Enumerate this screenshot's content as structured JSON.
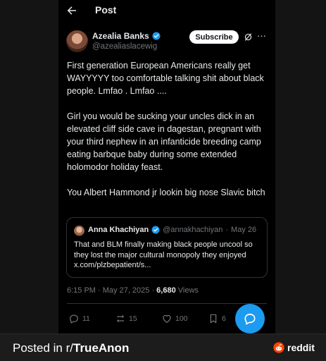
{
  "header": {
    "title": "Post",
    "back_icon": "arrow-left-icon"
  },
  "author": {
    "name": "Azealia Banks",
    "handle": "@azealiaslacewig",
    "verified_color": "#1d9bf0",
    "subscribe_label": "Subscribe",
    "more_label": "···"
  },
  "tweet": {
    "paragraphs": [
      "First generation European Americans really get WAYYYYY too comfortable talking shit about black people. Lmfao . Lmfao ....",
      "Girl you would be sucking your uncles dick in an elevated cliff side cave in dagestan, pregnant with your third nephew in an infanticide breeding camp eating barbque baby during some extended holomodor holiday feast.",
      "You Albert Hammond jr lookin big nose Slavic bitch"
    ]
  },
  "quote": {
    "name": "Anna Khachiyan",
    "handle": "@annakhachiyan",
    "separator": "·",
    "date": "May 26",
    "text": "That and BLM finally making black people uncool so they lost the major cultural monopoly they enjoyed x.com/plzbepatient/s..."
  },
  "meta": {
    "time": "6:15 PM · May 27, 2025 · ",
    "views_count": "6,680",
    "views_label": " Views"
  },
  "actions": {
    "replies": "11",
    "reposts": "15",
    "likes": "100",
    "bookmarks": "6"
  },
  "footer": {
    "posted_prefix": "Posted in r/",
    "subreddit": "TrueAnon",
    "brand": "reddit",
    "brand_color": "#ff4500"
  }
}
